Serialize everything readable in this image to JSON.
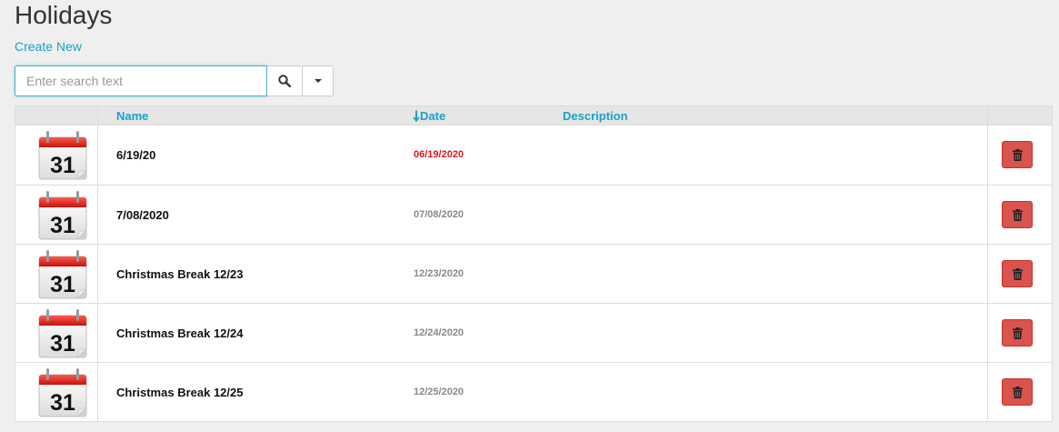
{
  "page": {
    "title": "Holidays",
    "create_link": "Create New"
  },
  "search": {
    "placeholder": "Enter search text",
    "value": ""
  },
  "grid": {
    "columns": [
      {
        "label": "Name"
      },
      {
        "label": "Date",
        "sort": "descending",
        "sort_icon": "arrow-down-icon"
      },
      {
        "label": "Description"
      }
    ],
    "rows": [
      {
        "icon": "calendar-icon",
        "icon_day": "31",
        "name": "6/19/20",
        "date": "06/19/2020",
        "date_color": "#e0141e",
        "description": ""
      },
      {
        "icon": "calendar-icon",
        "icon_day": "31",
        "name": "7/08/2020",
        "date": "07/08/2020",
        "date_color": "#888888",
        "description": ""
      },
      {
        "icon": "calendar-icon",
        "icon_day": "31",
        "name": "Christmas Break 12/23",
        "date": "12/23/2020",
        "date_color": "#888888",
        "description": ""
      },
      {
        "icon": "calendar-icon",
        "icon_day": "31",
        "name": "Christmas Break 12/24",
        "date": "12/24/2020",
        "date_color": "#888888",
        "description": ""
      },
      {
        "icon": "calendar-icon",
        "icon_day": "31",
        "name": "Christmas Break 12/25",
        "date": "12/25/2020",
        "date_color": "#888888",
        "description": ""
      }
    ]
  },
  "colors": {
    "link": "#1ba0c8",
    "delete_button": "#d9534f",
    "highlight_date": "#e0141e"
  }
}
